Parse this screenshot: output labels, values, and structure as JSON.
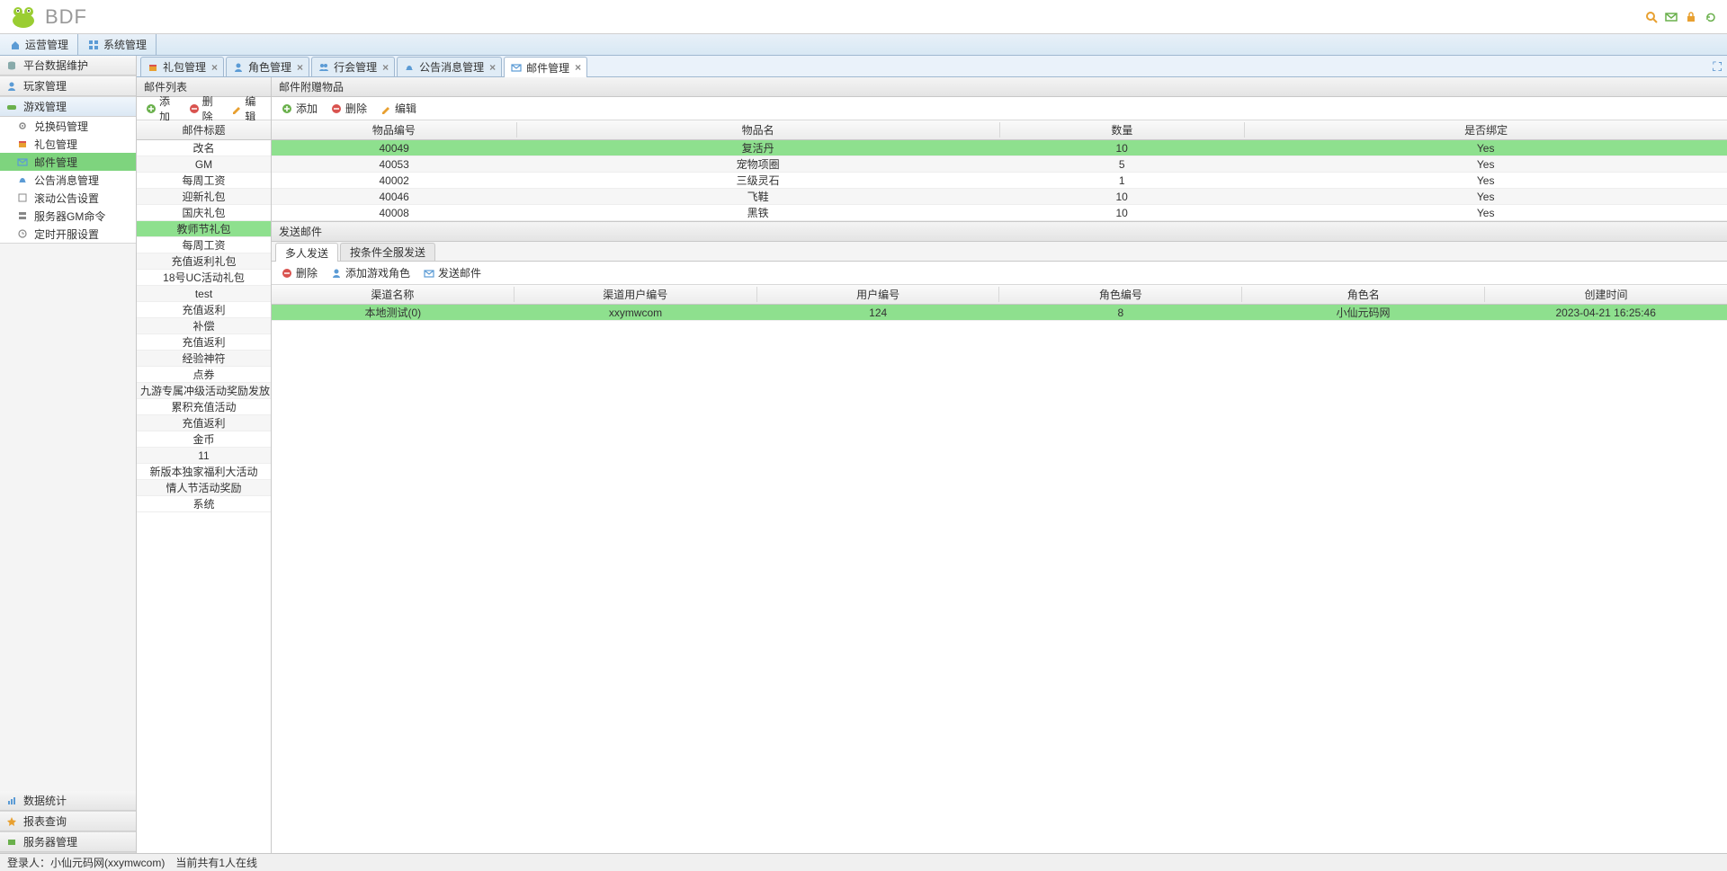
{
  "app": {
    "title": "BDF"
  },
  "headerIcons": [
    "search",
    "mail",
    "lock",
    "refresh"
  ],
  "mainTabs": [
    {
      "label": "运营管理",
      "icon": "home",
      "active": true
    },
    {
      "label": "系统管理",
      "icon": "grid",
      "active": false
    }
  ],
  "sidebar": {
    "top": [
      {
        "label": "平台数据维护",
        "icon": "db",
        "expanded": false
      },
      {
        "label": "玩家管理",
        "icon": "user",
        "expanded": false
      },
      {
        "label": "游戏管理",
        "icon": "game",
        "expanded": true,
        "items": [
          {
            "label": "兑换码管理",
            "icon": "gear"
          },
          {
            "label": "礼包管理",
            "icon": "gift"
          },
          {
            "label": "邮件管理",
            "icon": "mail",
            "active": true
          },
          {
            "label": "公告消息管理",
            "icon": "bell"
          },
          {
            "label": "滚动公告设置",
            "icon": "scroll"
          },
          {
            "label": "服务器GM命令",
            "icon": "server"
          },
          {
            "label": "定时开服设置",
            "icon": "clock"
          }
        ]
      }
    ],
    "bottom": [
      {
        "label": "数据统计",
        "icon": "chart"
      },
      {
        "label": "报表查询",
        "icon": "star"
      },
      {
        "label": "服务器管理",
        "icon": "server2"
      }
    ]
  },
  "tabs": [
    {
      "label": "礼包管理",
      "icon": "gift",
      "active": false
    },
    {
      "label": "角色管理",
      "icon": "user",
      "active": false
    },
    {
      "label": "行会管理",
      "icon": "group",
      "active": false
    },
    {
      "label": "公告消息管理",
      "icon": "bell",
      "active": false
    },
    {
      "label": "邮件管理",
      "icon": "mail",
      "active": true
    }
  ],
  "mailList": {
    "title": "邮件列表",
    "toolbar": {
      "add": "添加",
      "delete": "删除",
      "edit": "编辑"
    },
    "header": "邮件标题",
    "rows": [
      "改名",
      "GM",
      "每周工资",
      "迎新礼包",
      "国庆礼包",
      "教师节礼包",
      "每周工资",
      "充值返利礼包",
      "18号UC活动礼包",
      "test",
      "充值返利",
      "补偿",
      "充值返利",
      "经验神符",
      "点券",
      "九游专属冲级活动奖励发放",
      "累积充值活动",
      "充值返利",
      "金币",
      "11",
      "新版本独家福利大活动",
      "情人节活动奖励",
      "系统"
    ],
    "selectedIndex": 5
  },
  "items": {
    "title": "邮件附赠物品",
    "toolbar": {
      "add": "添加",
      "delete": "删除",
      "edit": "编辑"
    },
    "headers": [
      "物品编号",
      "物品名",
      "数量",
      "是否绑定"
    ],
    "rows": [
      {
        "id": "40049",
        "name": "复活丹",
        "qty": "10",
        "bind": "Yes",
        "selected": true
      },
      {
        "id": "40053",
        "name": "宠物项圈",
        "qty": "5",
        "bind": "Yes"
      },
      {
        "id": "40002",
        "name": "三级灵石",
        "qty": "1",
        "bind": "Yes"
      },
      {
        "id": "40046",
        "name": "飞鞋",
        "qty": "10",
        "bind": "Yes"
      },
      {
        "id": "40008",
        "name": "黑铁",
        "qty": "10",
        "bind": "Yes"
      }
    ]
  },
  "send": {
    "title": "发送邮件",
    "subtabs": [
      {
        "label": "多人发送",
        "active": true
      },
      {
        "label": "按条件全服发送",
        "active": false
      }
    ],
    "toolbar": {
      "delete": "删除",
      "addRole": "添加游戏角色",
      "sendMail": "发送邮件"
    },
    "headers": [
      "渠道名称",
      "渠道用户编号",
      "用户编号",
      "角色编号",
      "角色名",
      "创建时间"
    ],
    "rows": [
      {
        "channel": "本地测试(0)",
        "channelUser": "xxymwcom",
        "userId": "124",
        "roleId": "8",
        "roleName": "小仙元码网",
        "created": "2023-04-21 16:25:46",
        "selected": true
      }
    ]
  },
  "footer": {
    "login": "登录人：小仙元码网(xxymwcom)",
    "online": "当前共有1人在线"
  }
}
